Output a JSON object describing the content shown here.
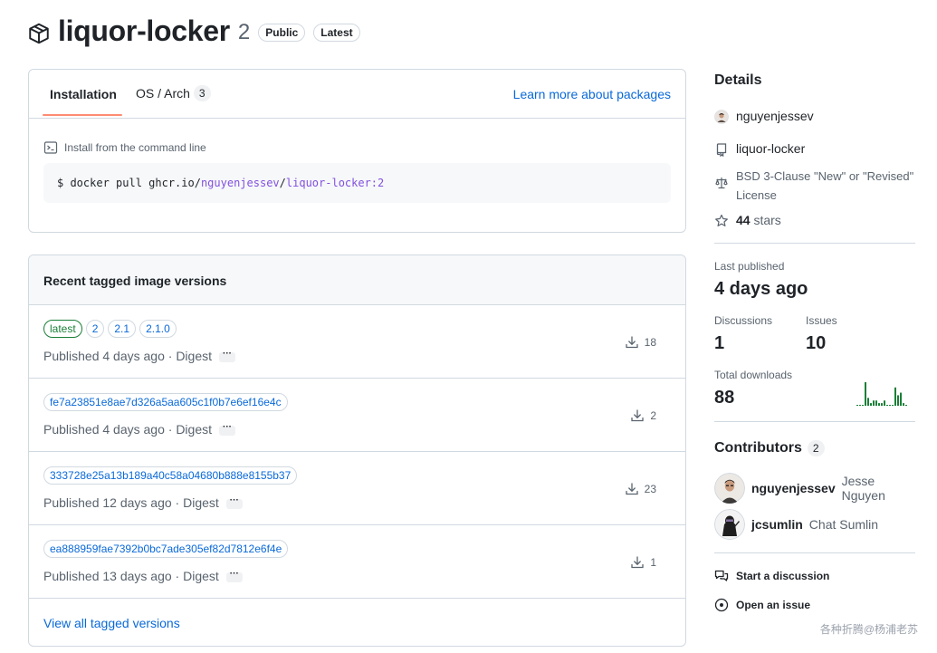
{
  "header": {
    "package_name": "liquor-locker",
    "version_count": "2",
    "badge_public": "Public",
    "badge_latest": "Latest"
  },
  "install_box": {
    "tab_installation": "Installation",
    "tab_os_arch": "OS / Arch",
    "tab_os_arch_count": "3",
    "learn_more": "Learn more about packages",
    "install_label": "Install from the command line",
    "command_prefix": "$ docker pull ghcr.io/",
    "command_owner": "nguyenjessev",
    "command_sep": "/",
    "command_image": "liquor-locker:2"
  },
  "versions": {
    "title": "Recent tagged image versions",
    "rows": [
      {
        "tags": [
          "latest",
          "2",
          "2.1",
          "2.1.0"
        ],
        "published": "Published 4 days ago · Digest",
        "downloads": "18"
      },
      {
        "tags": [
          "fe7a23851e8ae7d326a5aa605c1f0b7e6ef16e4c"
        ],
        "published": "Published 4 days ago · Digest",
        "downloads": "2"
      },
      {
        "tags": [
          "333728e25a13b189a40c58a04680b888e8155b37"
        ],
        "published": "Published 12 days ago · Digest",
        "downloads": "23"
      },
      {
        "tags": [
          "ea888959fae7392b0bc7ade305ef82d7812e6f4e"
        ],
        "published": "Published 13 days ago · Digest",
        "downloads": "1"
      }
    ],
    "ellipsis": "···",
    "view_all": "View all tagged versions"
  },
  "details": {
    "title": "Details",
    "owner": "nguyenjessev",
    "repo": "liquor-locker",
    "license": "BSD 3-Clause \"New\" or \"Revised\" License",
    "stars_count": "44",
    "stars_label": "stars",
    "last_published_label": "Last published",
    "last_published": "4 days ago",
    "discussions_label": "Discussions",
    "discussions": "1",
    "issues_label": "Issues",
    "issues": "10",
    "total_downloads_label": "Total downloads",
    "total_downloads": "88",
    "sparkline": [
      0,
      0,
      0,
      9,
      3,
      1,
      2,
      2,
      1,
      1,
      2,
      0,
      0,
      0,
      7,
      4,
      5,
      1,
      0
    ],
    "sparkline_color": "#1a7f37"
  },
  "contributors": {
    "title": "Contributors",
    "count": "2",
    "people": [
      {
        "login": "nguyenjessev",
        "name": "Jesse Nguyen"
      },
      {
        "login": "jcsumlin",
        "name": "Chat Sumlin"
      }
    ]
  },
  "actions": {
    "start_discussion": "Start a discussion",
    "open_issue": "Open an issue"
  },
  "watermark": "各种折腾@杨浦老苏",
  "colors": {
    "link": "#0969da",
    "tab_underline": "#fd8c73",
    "latest_tag": "#1a7f37",
    "purple_code": "#8250df"
  }
}
